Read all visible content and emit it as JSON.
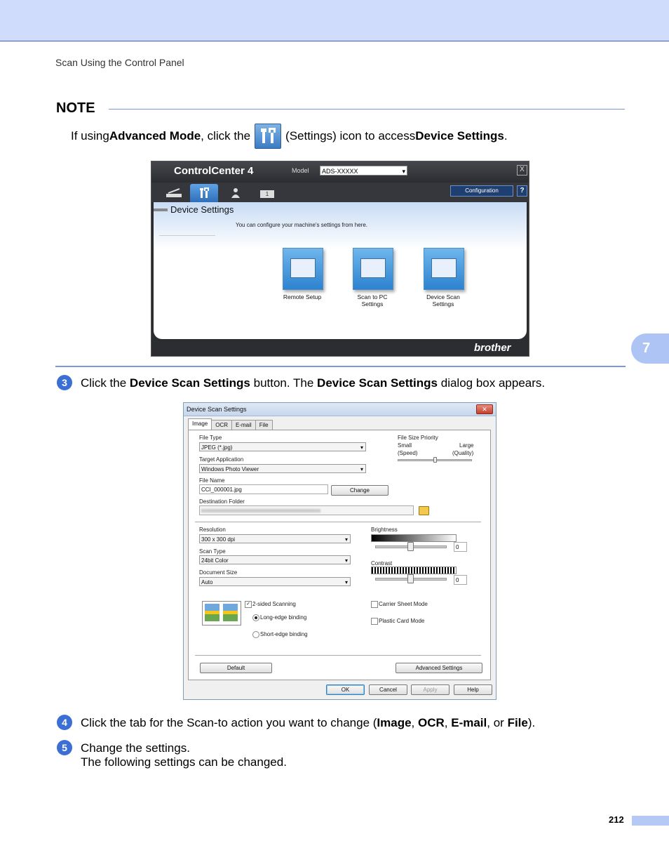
{
  "header": {
    "section": "Scan Using the Control Panel"
  },
  "note": {
    "title": "NOTE",
    "p1": "If using ",
    "b1": "Advanced Mode",
    "p2": ", click the ",
    "p3": " (Settings) icon to access ",
    "b2": "Device Settings",
    "p4": "."
  },
  "control_center": {
    "logo": "ControlCenter 4",
    "model_label": "Model",
    "model_value": "ADS-XXXXX",
    "configuration": "Configuration",
    "help": "?",
    "close": "X",
    "tab_number": "1",
    "panel_title": "Device Settings",
    "panel_subtitle": "You can configure your machine's settings from here.",
    "buttons": [
      "Remote Setup",
      "Scan to PC Settings",
      "Device Scan Settings"
    ],
    "brand": "brother"
  },
  "side_tab": "7",
  "steps": {
    "s3": {
      "num": "3",
      "t1": "Click the ",
      "b1": "Device Scan Settings",
      "t2": " button. The ",
      "b2": "Device Scan Settings",
      "t3": " dialog box appears."
    },
    "s4": {
      "num": "4",
      "t1": "Click the tab for the Scan-to action you want to change (",
      "b1": "Image",
      "t2": ", ",
      "b2": "OCR",
      "t3": ", ",
      "b3": "E-mail",
      "t4": ", or ",
      "b4": "File",
      "t5": ")."
    },
    "s5": {
      "num": "5",
      "line1": "Change the settings.",
      "line2": "The following settings can be changed."
    }
  },
  "dialog": {
    "title": "Device Scan Settings",
    "tabs": [
      "Image",
      "OCR",
      "E-mail",
      "File"
    ],
    "file_type_label": "File Type",
    "file_type": "JPEG (*.jpg)",
    "target_app_label": "Target Application",
    "target_app": "Windows Photo Viewer",
    "file_name_label": "File Name",
    "file_name": "CCI_000001.jpg",
    "change": "Change",
    "dest_folder_label": "Destination Folder",
    "file_size_label": "File Size Priority",
    "small": "Small",
    "speed": "(Speed)",
    "large": "Large",
    "quality": "(Quality)",
    "resolution_label": "Resolution",
    "resolution": "300 x 300 dpi",
    "scan_type_label": "Scan Type",
    "scan_type": "24bit Color",
    "doc_size_label": "Document Size",
    "doc_size": "Auto",
    "brightness_label": "Brightness",
    "brightness_value": "0",
    "contrast_label": "Contrast",
    "contrast_value": "0",
    "two_sided": "2-sided Scanning",
    "long_edge": "Long-edge binding",
    "short_edge": "Short-edge binding",
    "carrier_sheet": "Carrier Sheet Mode",
    "plastic_card": "Plastic Card Mode",
    "default": "Default",
    "advanced": "Advanced Settings",
    "ok": "OK",
    "cancel": "Cancel",
    "apply": "Apply",
    "help": "Help"
  },
  "page_number": "212"
}
